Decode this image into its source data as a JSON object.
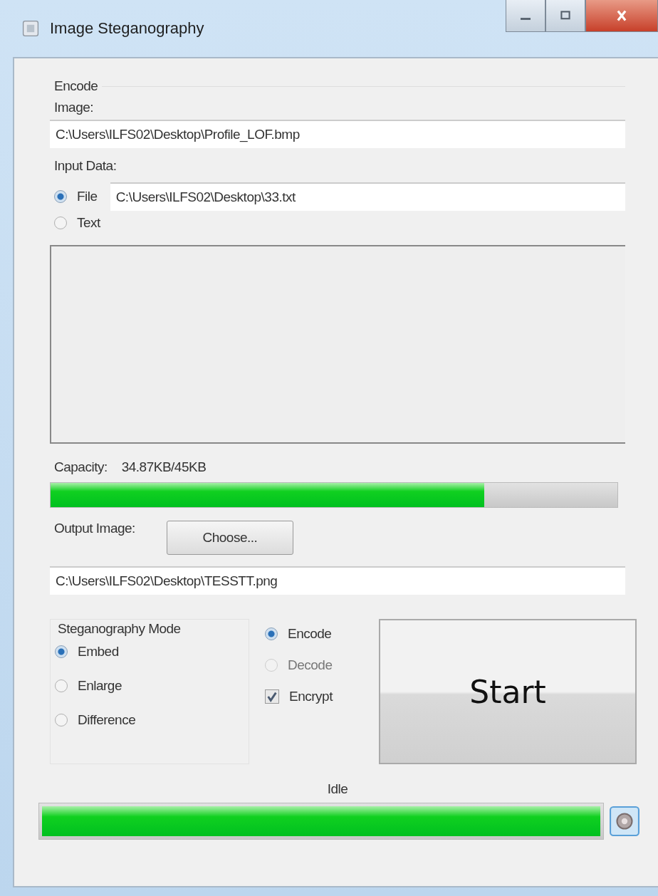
{
  "window": {
    "title": "Image Steganography"
  },
  "group_title": "Encode",
  "image": {
    "label": "Image:",
    "value": "C:\\Users\\ILFS02\\Desktop\\Profile_LOF.bmp"
  },
  "input_data": {
    "label": "Input Data:",
    "options": [
      {
        "label": "File",
        "selected": true,
        "value": "C:\\Users\\ILFS02\\Desktop\\33.txt"
      },
      {
        "label": "Text",
        "selected": false
      }
    ]
  },
  "capacity": {
    "label": "Capacity:",
    "reading": "34.87KB/45KB",
    "level": 0.765
  },
  "output": {
    "label": "Output Image:",
    "button": "Choose...",
    "value": "C:\\Users\\ILFS02\\Desktop\\TESSTT.png"
  },
  "mode": {
    "title": "Steganography Mode",
    "options": [
      {
        "label": "Embed",
        "selected": true
      },
      {
        "label": "Enlarge",
        "selected": false
      },
      {
        "label": "Difference",
        "selected": false
      }
    ]
  },
  "direction": [
    {
      "label": "Encode",
      "selected": true,
      "disabled": false
    },
    {
      "label": "Decode",
      "selected": false,
      "disabled": true
    }
  ],
  "encrypt": {
    "label": "Encrypt",
    "checked": true
  },
  "start_button": "Start",
  "status": {
    "text": "Idle",
    "level": 1
  }
}
